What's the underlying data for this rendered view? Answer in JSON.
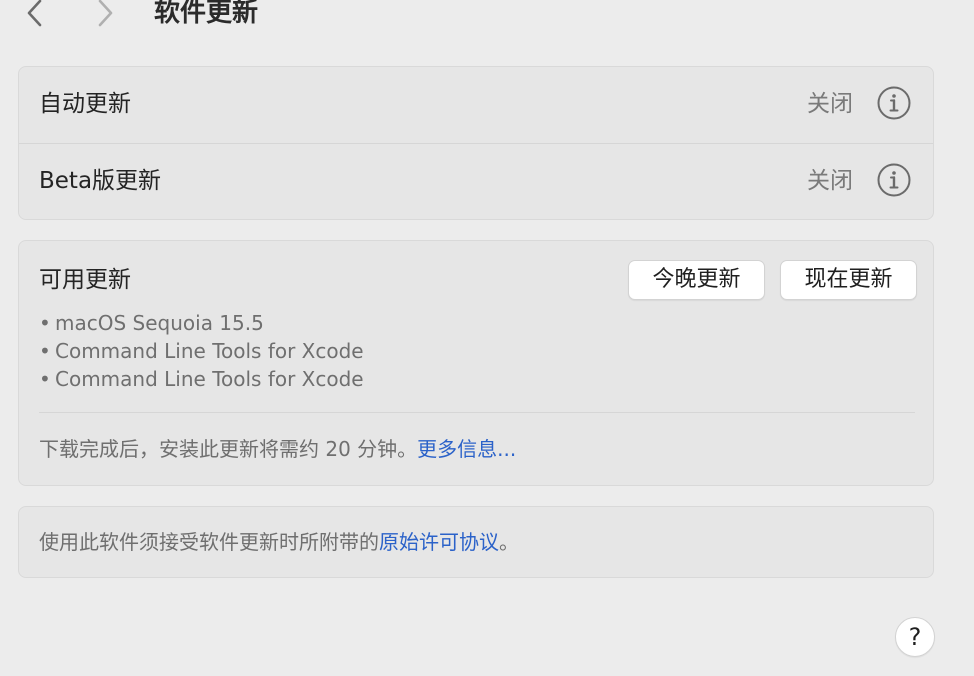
{
  "header": {
    "title": "软件更新",
    "back_icon": "chevron-left-icon",
    "forward_icon": "chevron-right-icon"
  },
  "settings": {
    "rows": [
      {
        "label": "自动更新",
        "value": "关闭",
        "icon": "info-icon"
      },
      {
        "label": "Beta版更新",
        "value": "关闭",
        "icon": "info-icon"
      }
    ]
  },
  "updates": {
    "title": "可用更新",
    "tonight_button": "今晚更新",
    "now_button": "现在更新",
    "items": [
      "macOS Sequoia 15.5",
      "Command Line Tools for Xcode",
      "Command Line Tools for Xcode"
    ],
    "bullet": "•",
    "note": "下载完成后，安装此更新将需约 20 分钟。",
    "more_info_link": "更多信息..."
  },
  "license": {
    "text": "使用此软件须接受软件更新时所附带的",
    "link": "原始许可协议",
    "suffix": "。"
  },
  "help": {
    "label": "?"
  },
  "colors": {
    "background": "#ececec",
    "card": "#e6e6e6",
    "link": "#2b62c9",
    "secondary_text": "#6f6f6f"
  }
}
